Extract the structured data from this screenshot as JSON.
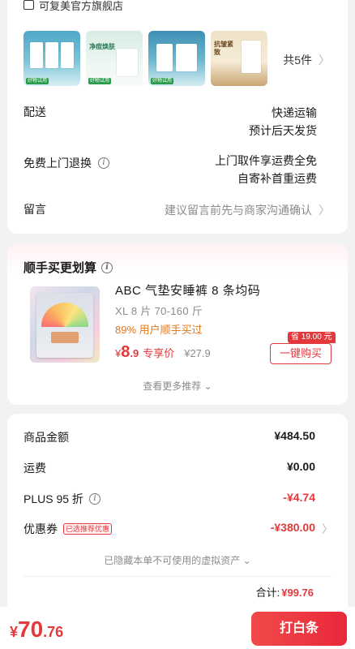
{
  "store": {
    "name": "可复美官方旗舰店"
  },
  "items": {
    "thumbnails": [
      {
        "tag": "好物试用",
        "caption": "夫肯包"
      },
      {
        "tag": "好物试用",
        "caption": "净痘焕肤"
      },
      {
        "tag": "好物试用",
        "caption": ""
      },
      {
        "tag": "",
        "caption": "抗皱紧致"
      }
    ],
    "count_label": "共5件"
  },
  "delivery": {
    "label": "配送",
    "method": "快递运输",
    "eta": "预计后天发货"
  },
  "returns": {
    "label": "免费上门退换",
    "line1": "上门取件享运费全免",
    "line2": "自寄补首重运费"
  },
  "message": {
    "label": "留言",
    "placeholder": "建议留言前先与商家沟通确认"
  },
  "recommend": {
    "title": "顺手买更划算",
    "product_name": "ABC 气垫安睡裤 8 条均码",
    "product_spec": "XL 8 片 70-160 斤",
    "rate_text": "89% 用户顺手买过",
    "price_symbol": "¥",
    "price_int": "8",
    "price_dec": ".9",
    "price_tag": "专享价",
    "orig_price": "¥27.9",
    "save_badge": "省 19.00 元",
    "buy_label": "一键购买",
    "more_label": "查看更多推荐 ⌄"
  },
  "summary": {
    "goods_label": "商品金额",
    "goods_value": "¥484.50",
    "shipping_label": "运费",
    "shipping_value": "¥0.00",
    "plus_label": "PLUS 95 折",
    "plus_value": "-¥4.74",
    "coupon_label": "优惠券",
    "coupon_tag": "已选推荐优惠",
    "coupon_value": "-¥380.00",
    "hidden_note": "已隐藏本单不可使用的虚拟资产 ⌄",
    "total_label": "合计:",
    "total_value": "¥99.76"
  },
  "payment": {
    "symbol": "¥",
    "int": "70",
    "dec": ".76",
    "button_label": "打白条"
  },
  "colors": {
    "accent_red": "#e4393c",
    "orange": "#e0781b",
    "muted": "#8c8c8c"
  }
}
